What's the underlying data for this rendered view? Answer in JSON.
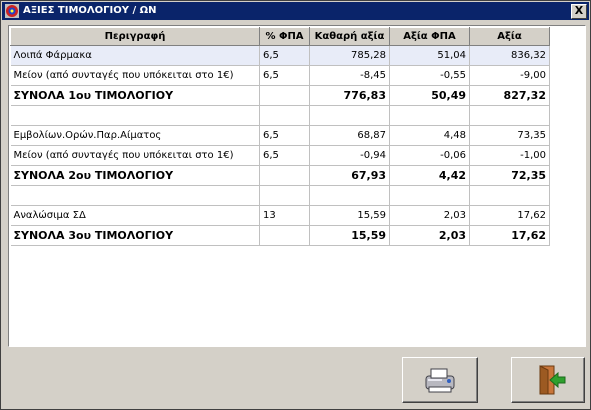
{
  "window": {
    "title": "ΑΞΙΕΣ ΤΙΜΟΛΟΓΙΟΥ / ΩΝ",
    "close_glyph": "X"
  },
  "table": {
    "columns": [
      "Περιγραφή",
      "% ΦΠΑ",
      "Καθαρή αξία",
      "Αξία ΦΠΑ",
      "Αξία"
    ],
    "rows": [
      {
        "desc": "Λοιπά Φάρμακα",
        "vat_pct": "6,5",
        "net": "785,28",
        "vat": "51,04",
        "total": "836,32"
      },
      {
        "desc": "Μείον (από συνταγές που υπόκειται στο 1€)",
        "vat_pct": "6,5",
        "net": "-8,45",
        "vat": "-0,55",
        "total": "-9,00"
      },
      {
        "desc": "ΣΥΝΟΛΑ 1ου ΤΙΜΟΛΟΓΙΟΥ",
        "vat_pct": "",
        "net": "776,83",
        "vat": "50,49",
        "total": "827,32"
      },
      {
        "desc": "",
        "vat_pct": "",
        "net": "",
        "vat": "",
        "total": ""
      },
      {
        "desc": "Εμβολίων.Ορών.Παρ.Αίματος",
        "vat_pct": "6,5",
        "net": "68,87",
        "vat": "4,48",
        "total": "73,35"
      },
      {
        "desc": "Μείον (από συνταγές που υπόκειται στο 1€)",
        "vat_pct": "6,5",
        "net": "-0,94",
        "vat": "-0,06",
        "total": "-1,00"
      },
      {
        "desc": "ΣΥΝΟΛΑ 2ου ΤΙΜΟΛΟΓΙΟΥ",
        "vat_pct": "",
        "net": "67,93",
        "vat": "4,42",
        "total": "72,35"
      },
      {
        "desc": "",
        "vat_pct": "",
        "net": "",
        "vat": "",
        "total": ""
      },
      {
        "desc": "Αναλώσιμα ΣΔ",
        "vat_pct": "13",
        "net": "15,59",
        "vat": "2,03",
        "total": "17,62"
      },
      {
        "desc": "ΣΥΝΟΛΑ 3ου ΤΙΜΟΛΟΓΙΟΥ",
        "vat_pct": "",
        "net": "15,59",
        "vat": "2,03",
        "total": "17,62"
      }
    ]
  },
  "buttons": {
    "print": "printer-icon",
    "exit": "exit-door-icon"
  },
  "colors": {
    "titlebar": "#0a246a",
    "selected_row": "#e8ecf8",
    "exit_arrow": "#2ea02e"
  }
}
